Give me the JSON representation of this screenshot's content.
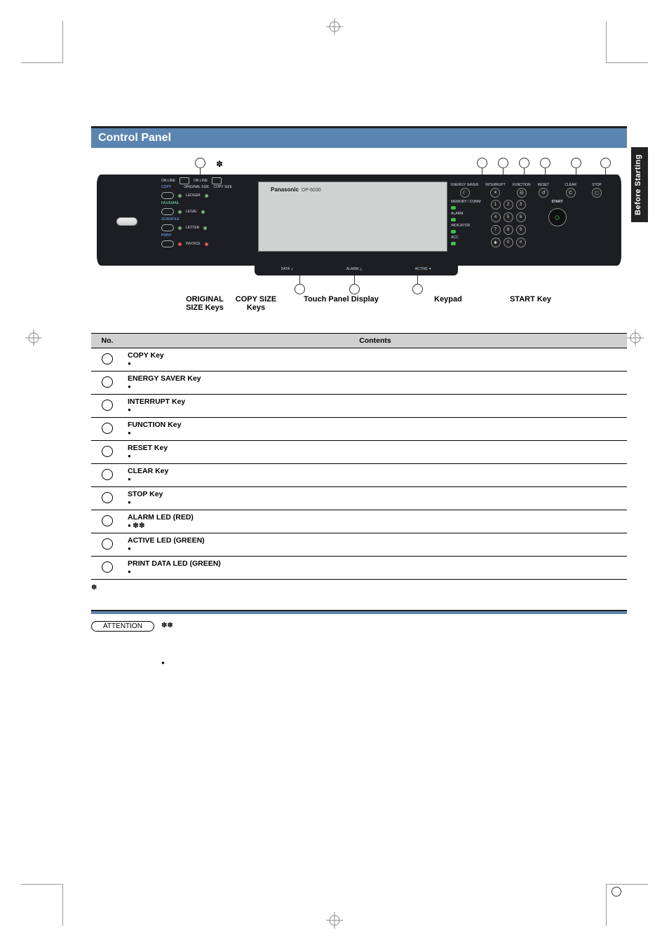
{
  "title": "Control Panel",
  "side_tab": "Before Starting",
  "diagram": {
    "brand": "Panasonic",
    "brand_model": "DP-6030",
    "top_left_labels": [
      "ON LINE",
      "ON LINE"
    ],
    "left_rows": [
      {
        "label": "COPY",
        "right1": "ORIGINAL SIZE",
        "right2": "COPY SIZE"
      },
      {
        "label": "",
        "right": "LEDGER"
      },
      {
        "label": "FAX/EMAIL",
        "right": "LEGAL"
      },
      {
        "label": "SCAN/FILE",
        "right": "LETTER"
      },
      {
        "label": "PRINT",
        "right": "INVOICE"
      }
    ],
    "right_top": [
      "ENERGY SAVER",
      "INTERRUPT",
      "FUNCTION",
      "RESET"
    ],
    "right_clear": "CLEAR",
    "right_stop": "STOP",
    "right_start": "START",
    "status_col": [
      "MEMORY / COMM",
      "ALARM",
      "INDICATOR",
      "ACC"
    ],
    "keypad": [
      "1",
      "2",
      "3",
      "4",
      "5",
      "6",
      "7",
      "8",
      "9",
      "✱",
      "0",
      "#"
    ],
    "lower_strip": [
      {
        "label": "DATA",
        "icon": "⇣"
      },
      {
        "label": "ALARM",
        "icon": "△"
      },
      {
        "label": "ACTIVE",
        "icon": "✶"
      }
    ],
    "callout_labels": [
      "ORIGINAL SIZE Keys",
      "COPY SIZE Keys",
      "Touch Panel Display",
      "Keypad",
      "START Key"
    ]
  },
  "table": {
    "headers": {
      "no": "No.",
      "contents": "Contents"
    },
    "rows": [
      {
        "name": "COPY Key",
        "desc": ""
      },
      {
        "name": "ENERGY SAVER Key",
        "desc": ""
      },
      {
        "name": "INTERRUPT Key",
        "desc": ""
      },
      {
        "name": "FUNCTION Key",
        "desc": ""
      },
      {
        "name": "RESET Key",
        "desc": ""
      },
      {
        "name": "CLEAR Key",
        "desc": ""
      },
      {
        "name": "STOP Key",
        "desc": ""
      },
      {
        "name": "ALARM LED (RED)",
        "desc": "",
        "dblstar": true
      },
      {
        "name": "ACTIVE LED (GREEN)",
        "desc": ""
      },
      {
        "name": "PRINT DATA LED (GREEN)",
        "desc": ""
      }
    ]
  },
  "footnote": "",
  "attention": {
    "label": "ATTENTION",
    "see": "",
    "bullets": [
      ""
    ]
  },
  "page_number": ""
}
